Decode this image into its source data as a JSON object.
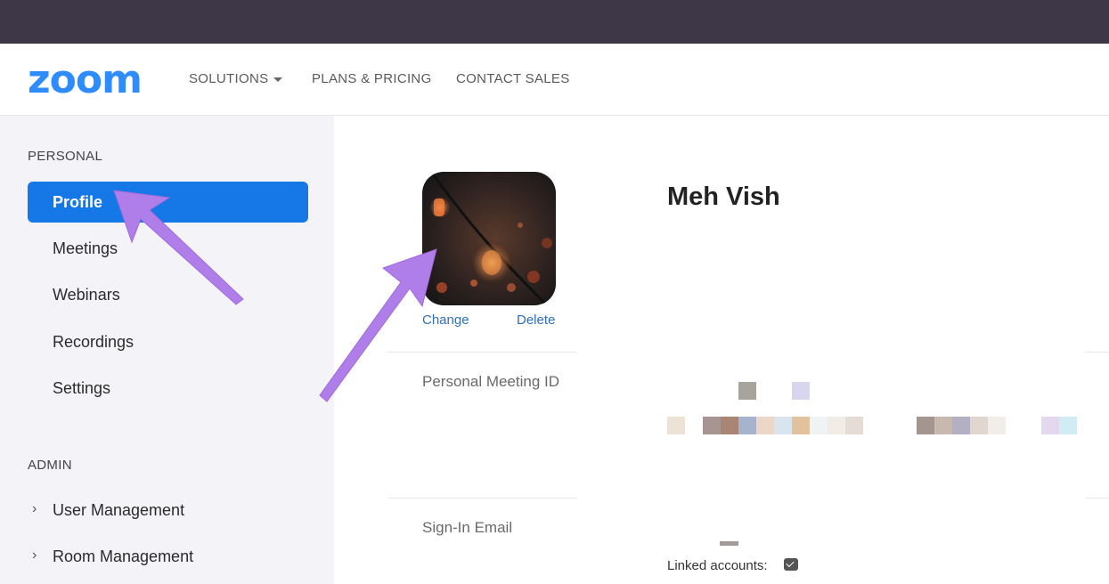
{
  "header": {
    "logo": "zoom",
    "nav": {
      "solutions": "SOLUTIONS",
      "plans": "PLANS & PRICING",
      "contact": "CONTACT SALES"
    }
  },
  "sidebar": {
    "personal_label": "PERSONAL",
    "items": [
      {
        "label": "Profile"
      },
      {
        "label": "Meetings"
      },
      {
        "label": "Webinars"
      },
      {
        "label": "Recordings"
      },
      {
        "label": "Settings"
      }
    ],
    "admin_label": "ADMIN",
    "admin_items": [
      {
        "label": "User Management"
      },
      {
        "label": "Room Management"
      }
    ]
  },
  "profile": {
    "name": "Meh Vish",
    "change": "Change",
    "delete": "Delete",
    "pmi_label": "Personal Meeting ID",
    "email_label": "Sign-In Email",
    "linked_label": "Linked accounts:"
  },
  "colors": {
    "brand": "#2D8CFF",
    "active": "#1677e6",
    "annotation_arrow": "#b07ee8"
  }
}
